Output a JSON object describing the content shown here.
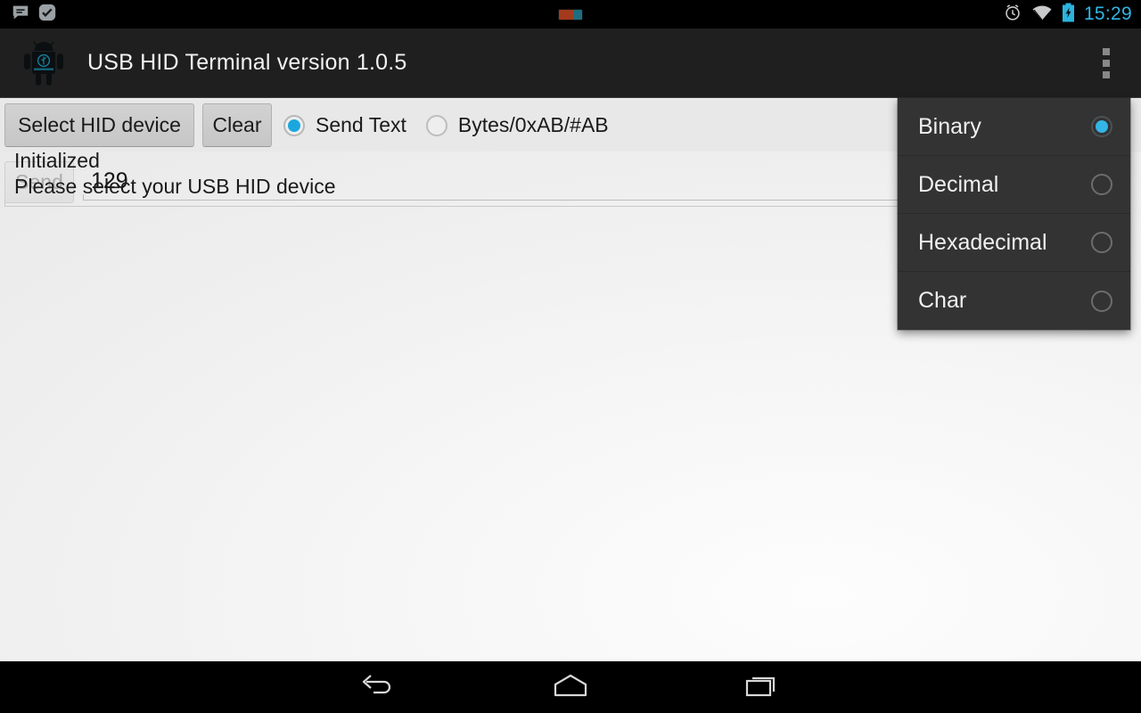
{
  "statusbar": {
    "notifications": [
      {
        "icon": "message-bubble-icon"
      },
      {
        "icon": "check-badge-icon"
      }
    ],
    "usb_indicator_icon": "usb-connection-icon",
    "alarm_icon": "alarm-clock-icon",
    "wifi_icon": "wifi-icon",
    "battery_icon": "battery-charging-icon",
    "clock": "15:29",
    "accent_color": "#33b5e5"
  },
  "actionbar": {
    "app_icon": "android-robot-app-icon",
    "title": "USB HID Terminal version 1.0.5",
    "overflow_icon": "overflow-menu-icon",
    "background_color": "#1f1f1f"
  },
  "toolbar": {
    "select_device_label": "Select HID device",
    "clear_label": "Clear",
    "send_label": "Send",
    "send_enabled": false,
    "mode_options": [
      {
        "label": "Send Text",
        "selected": true
      },
      {
        "label": "Bytes/0xAB/#AB",
        "selected": false
      }
    ]
  },
  "input": {
    "value": "129",
    "placeholder": ""
  },
  "log": {
    "lines": [
      "Initialized",
      "Please select your USB HID device"
    ]
  },
  "dropdown": {
    "visible": true,
    "selected": "Binary",
    "accent_color": "#33b5e5",
    "background_color": "#333333",
    "items": [
      {
        "label": "Binary",
        "selected": true
      },
      {
        "label": "Decimal",
        "selected": false
      },
      {
        "label": "Hexadecimal",
        "selected": false
      },
      {
        "label": "Char",
        "selected": false
      }
    ]
  },
  "navbar": {
    "back_icon": "back-arrow-icon",
    "home_icon": "home-icon",
    "recents_icon": "recent-apps-icon"
  }
}
